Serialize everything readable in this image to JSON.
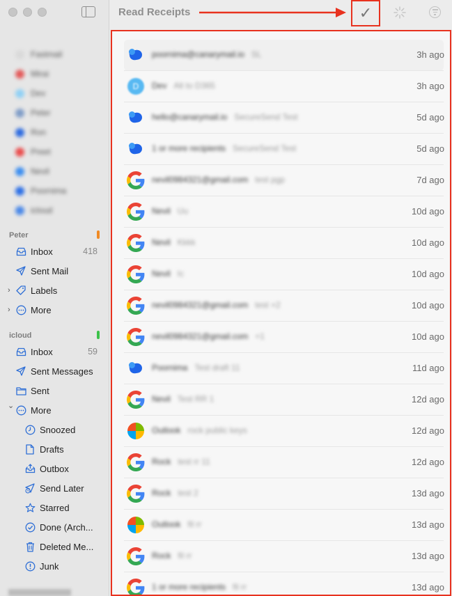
{
  "window": {
    "title": "Read Receipts"
  },
  "toolbar": {
    "check_glyph": "✓"
  },
  "sidebar": {
    "blurred_accounts": [
      {
        "name": "Fastmail",
        "color": "#d9d9d9"
      },
      {
        "name": "Mirai",
        "color": "#e35a5a"
      },
      {
        "name": "Dev",
        "color": "#8fd0f5"
      },
      {
        "name": "Peter",
        "color": "#7f9cc7"
      },
      {
        "name": "Ron",
        "color": "#2d6be0"
      },
      {
        "name": "Preet",
        "color": "#ea4d4d"
      },
      {
        "name": "Nevil",
        "color": "#3c8ef0"
      },
      {
        "name": "Poornima",
        "color": "#2c6fe6"
      },
      {
        "name": "icloud",
        "color": "#4a88e8"
      }
    ],
    "peter": {
      "heading": "Peter",
      "accent": "#f08a24",
      "items": [
        {
          "label": "Inbox",
          "count": "418",
          "icon": "inbox-icon"
        },
        {
          "label": "Sent Mail",
          "count": "",
          "icon": "paper-plane-icon"
        },
        {
          "label": "Labels",
          "count": "",
          "icon": "tag-icon"
        },
        {
          "label": "More",
          "count": "",
          "icon": "more-circle-icon"
        }
      ]
    },
    "icloud": {
      "heading": "icloud",
      "accent": "#3cc24a",
      "items": [
        {
          "label": "Inbox",
          "count": "59",
          "icon": "inbox-icon"
        },
        {
          "label": "Sent Messages",
          "count": "",
          "icon": "paper-plane-icon"
        },
        {
          "label": "Sent",
          "count": "",
          "icon": "folder-icon"
        },
        {
          "label": "More",
          "count": "",
          "icon": "more-circle-icon"
        }
      ],
      "more_items": [
        {
          "label": "Snoozed",
          "icon": "clock-icon"
        },
        {
          "label": "Drafts",
          "icon": "document-icon"
        },
        {
          "label": "Outbox",
          "icon": "outbox-icon"
        },
        {
          "label": "Send Later",
          "icon": "send-later-icon"
        },
        {
          "label": "Starred",
          "icon": "star-icon"
        },
        {
          "label": "Done (Arch...",
          "icon": "check-circle-icon"
        },
        {
          "label": "Deleted Me...",
          "icon": "trash-icon"
        },
        {
          "label": "Junk",
          "icon": "junk-icon"
        }
      ]
    }
  },
  "receipts": [
    {
      "sender": "poornima@canarymail.io",
      "subject": "SL",
      "time": "3h ago",
      "icon": "canary"
    },
    {
      "sender": "Dev",
      "subject": "Alt to D365",
      "time": "3h ago",
      "icon": "dev"
    },
    {
      "sender": "hello@canarymail.io",
      "subject": "SecureSend Test",
      "time": "5d ago",
      "icon": "canary"
    },
    {
      "sender": "1 or more recipients",
      "subject": "SecureSend Test",
      "time": "5d ago",
      "icon": "canary"
    },
    {
      "sender": "nevil0984321@gmail.com",
      "subject": "test pgp",
      "time": "7d ago",
      "icon": "google"
    },
    {
      "sender": "Nevil",
      "subject": "Uu",
      "time": "10d ago",
      "icon": "google"
    },
    {
      "sender": "Nevil",
      "subject": "Kkkk",
      "time": "10d ago",
      "icon": "google"
    },
    {
      "sender": "Nevil",
      "subject": "Ic",
      "time": "10d ago",
      "icon": "google"
    },
    {
      "sender": "nevil0984321@gmail.com",
      "subject": "test +2",
      "time": "10d ago",
      "icon": "google"
    },
    {
      "sender": "nevil0984321@gmail.com",
      "subject": "+1",
      "time": "10d ago",
      "icon": "google"
    },
    {
      "sender": "Poornima",
      "subject": "Test draft 11",
      "time": "11d ago",
      "icon": "canary"
    },
    {
      "sender": "Nevil",
      "subject": "Test RR 1",
      "time": "12d ago",
      "icon": "google"
    },
    {
      "sender": "Outlook",
      "subject": "rock public keys",
      "time": "12d ago",
      "icon": "microsoft"
    },
    {
      "sender": "Rock",
      "subject": "test rr 11",
      "time": "12d ago",
      "icon": "google"
    },
    {
      "sender": "Rock",
      "subject": "test 2",
      "time": "13d ago",
      "icon": "google"
    },
    {
      "sender": "Outlook",
      "subject": "fil rr",
      "time": "13d ago",
      "icon": "microsoft"
    },
    {
      "sender": "Rock",
      "subject": "fil rr",
      "time": "13d ago",
      "icon": "google"
    },
    {
      "sender": "1 or more recipients",
      "subject": "fil rr",
      "time": "13d ago",
      "icon": "google"
    }
  ]
}
